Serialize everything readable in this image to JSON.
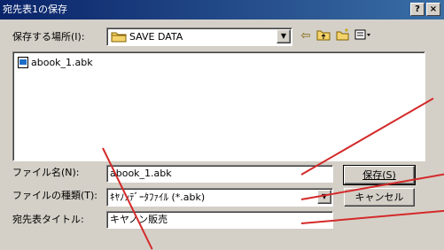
{
  "window": {
    "title": "宛先表1の保存",
    "help_label": "?",
    "close_label": "×"
  },
  "location": {
    "label": "保存する場所(I):",
    "value": "SAVE DATA"
  },
  "files": [
    {
      "name": "abook_1.abk"
    }
  ],
  "form": {
    "filename_label": "ファイル名(N):",
    "filename_value": "abook_1.abk",
    "filetype_label": "ファイルの種類(T):",
    "filetype_value": "ｷﾔﾉﾝﾃﾞｰﾀﾌｧｲﾙ (*.abk)",
    "title_label": "宛先表タイトル:",
    "title_value": "キヤノン販売"
  },
  "buttons": {
    "save": "保存(S)",
    "cancel": "キャンセル"
  },
  "icons": [
    "folder-icon",
    "back-arrow-icon",
    "up-folder-icon",
    "new-folder-icon",
    "view-menu-icon",
    "file-icon"
  ],
  "colors": {
    "title_bar": "#0a246a",
    "annotation_line": "#d42a2a",
    "dialog_bg": "#d4d0c8"
  }
}
